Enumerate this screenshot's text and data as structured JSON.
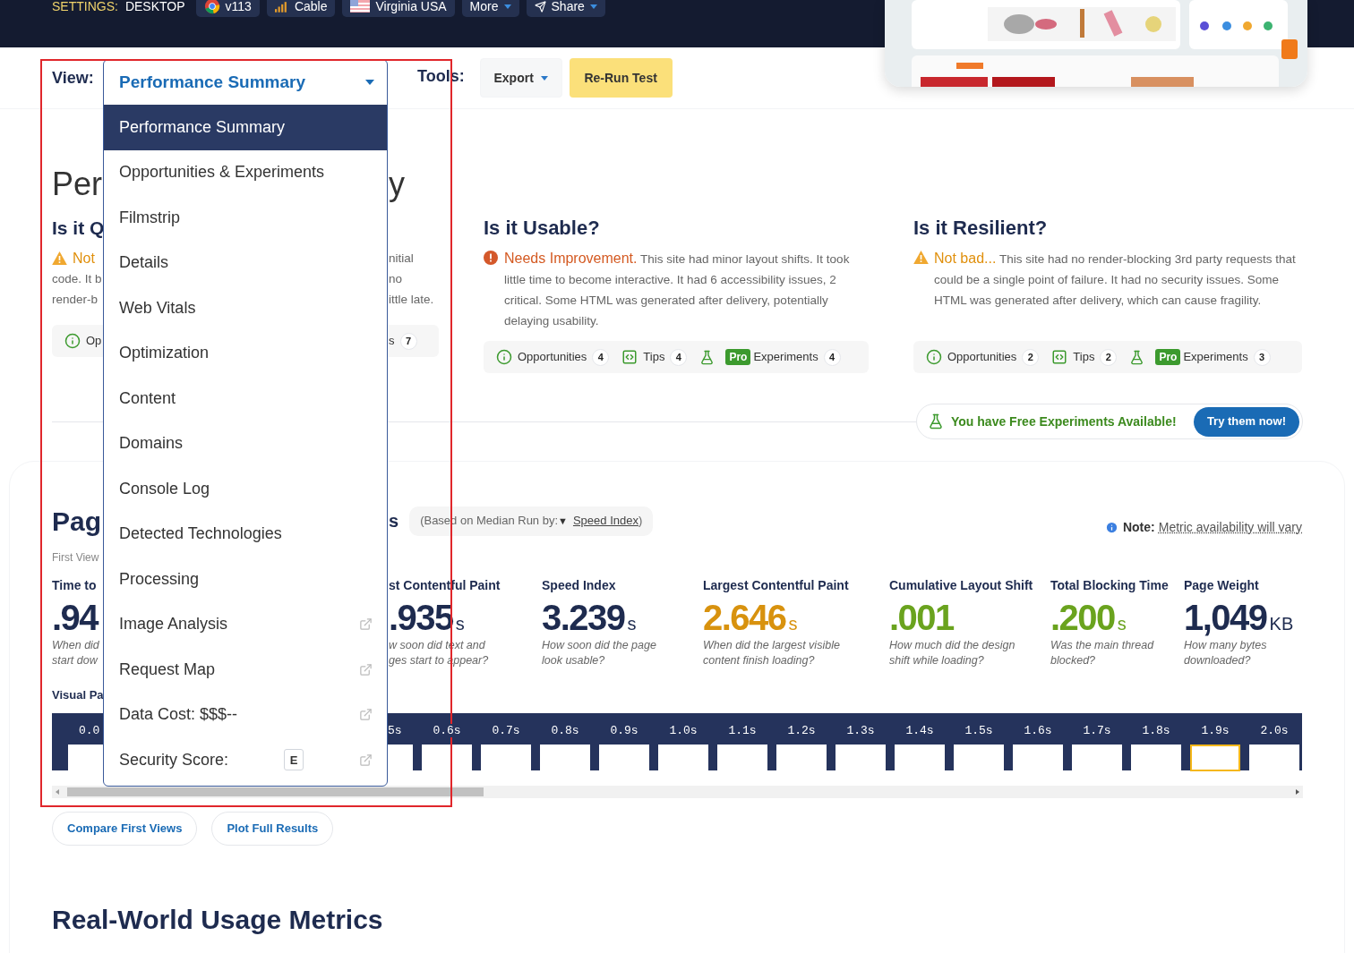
{
  "header": {
    "settings_label": "SETTINGS:",
    "settings_value": "DESKTOP",
    "chips": [
      {
        "kind": "browser",
        "label": "v113"
      },
      {
        "kind": "connection",
        "label": "Cable"
      },
      {
        "kind": "location",
        "label": "Virginia USA"
      },
      {
        "kind": "menu",
        "label": "More"
      },
      {
        "kind": "share",
        "label": "Share"
      }
    ]
  },
  "toolbar": {
    "view_label": "View:",
    "view_select": "Performance Summary",
    "tools_label": "Tools:",
    "export": "Export",
    "rerun": "Re-Run Test"
  },
  "view_menu": [
    {
      "label": "Performance Summary",
      "selected": true,
      "external": false
    },
    {
      "label": "Opportunities & Experiments",
      "selected": false,
      "external": false
    },
    {
      "label": "Filmstrip",
      "selected": false,
      "external": false
    },
    {
      "label": "Details",
      "selected": false,
      "external": false
    },
    {
      "label": "Web Vitals",
      "selected": false,
      "external": false
    },
    {
      "label": "Optimization",
      "selected": false,
      "external": false
    },
    {
      "label": "Content",
      "selected": false,
      "external": false
    },
    {
      "label": "Domains",
      "selected": false,
      "external": false
    },
    {
      "label": "Console Log",
      "selected": false,
      "external": false
    },
    {
      "label": "Detected Technologies",
      "selected": false,
      "external": false
    },
    {
      "label": "Processing",
      "selected": false,
      "external": false
    },
    {
      "label": "Image Analysis",
      "selected": false,
      "external": true
    },
    {
      "label": "Request Map",
      "selected": false,
      "external": true
    },
    {
      "label": "Data Cost: $$$--",
      "selected": false,
      "external": true
    },
    {
      "label": "Security Score:",
      "selected": false,
      "external": true,
      "badge": "E"
    }
  ],
  "summary": {
    "title_start": "Per",
    "title_end": "y",
    "left_section": {
      "heading": "Is it Q",
      "status": {
        "kind": "warning",
        "label": "Not"
      },
      "lines_left": [
        "code. It b",
        "render-b"
      ],
      "lines_right": [
        "nitial",
        "no",
        "ittle late."
      ],
      "chip_left": "Op",
      "chip_right": "s",
      "chip_right_count": "7"
    },
    "sections": [
      {
        "heading": "Is it Usable?",
        "status": {
          "kind": "error",
          "label": "Needs Improvement."
        },
        "text": "This site had minor layout shifts. It took little time to become interactive. It had 6 accessibility issues, 2 critical. Some HTML was generated after delivery, potentially delaying usability.",
        "opportunities": "Opportunities",
        "opportunities_count": "4",
        "tips": "Tips",
        "tips_count": "4",
        "pro": "Pro",
        "experiments": "Experiments",
        "experiments_count": "4"
      },
      {
        "heading": "Is it Resilient?",
        "status": {
          "kind": "warning",
          "label": "Not bad..."
        },
        "text": "This site had no render-blocking 3rd party requests that could be a single point of failure. It had no security issues. Some HTML was generated after delivery, which can cause fragility.",
        "opportunities": "Opportunities",
        "opportunities_count": "2",
        "tips": "Tips",
        "tips_count": "2",
        "pro": "Pro",
        "experiments": "Experiments",
        "experiments_count": "3"
      }
    ],
    "promo": {
      "text": "You have Free Experiments Available!",
      "button": "Try them now!"
    }
  },
  "metrics_section": {
    "title_start": "Pag",
    "title_end": "s",
    "median_prefix": "(Based on Median Run by:",
    "median_caret": "▼",
    "median_link": "Speed Index",
    "median_suffix": ")",
    "note_label": "Note:",
    "note_text": "Metric availability will vary",
    "view": "First View",
    "metrics": [
      {
        "label": "Time to",
        "value": ".94",
        "description": [
          "When did",
          "start dow"
        ],
        "color": "#1e2b4f"
      },
      {
        "label": "st Contentful Paint",
        "value": ".935",
        "unit": "s",
        "description": [
          "w soon did text and",
          "ges start to appear?"
        ],
        "color": "#1e2b4f"
      },
      {
        "label": "Speed Index",
        "value": "3.239",
        "unit": "s",
        "description": [
          "How soon did the page",
          "look usable?"
        ],
        "color": "#1e2b4f"
      },
      {
        "label": "Largest Contentful Paint",
        "value": "2.646",
        "unit": "s",
        "description": [
          "When did the largest visible",
          "content finish loading?"
        ],
        "color": "#d8920e"
      },
      {
        "label": "Cumulative Layout Shift",
        "value": ".001",
        "description": [
          "How much did the design",
          "shift while loading?"
        ],
        "color": "#6aa31e"
      },
      {
        "label": "Total Blocking Time",
        "value": ".200",
        "unit": "s",
        "description": [
          "Was the main thread",
          "blocked?"
        ],
        "color": "#6aa31e"
      },
      {
        "label": "Page Weight",
        "value": "1,049",
        "unit": "KB",
        "description": [
          "How many bytes",
          "downloaded?"
        ],
        "color": "#1e2b4f"
      }
    ],
    "filmstrip_label": "Visual Pa",
    "frames": [
      {
        "kind": "cut_right",
        "label": "0.0",
        "selected": false
      },
      {
        "kind": "cut_left",
        "label": "5s",
        "selected": false
      },
      {
        "kind": "full",
        "label": "0.6s",
        "selected": false
      },
      {
        "kind": "full",
        "label": "0.7s",
        "selected": false
      },
      {
        "kind": "full",
        "label": "0.8s",
        "selected": false
      },
      {
        "kind": "full",
        "label": "0.9s",
        "selected": false
      },
      {
        "kind": "full",
        "label": "1.0s",
        "selected": false
      },
      {
        "kind": "full",
        "label": "1.1s",
        "selected": false
      },
      {
        "kind": "full",
        "label": "1.2s",
        "selected": false
      },
      {
        "kind": "full",
        "label": "1.3s",
        "selected": false
      },
      {
        "kind": "full",
        "label": "1.4s",
        "selected": false
      },
      {
        "kind": "full",
        "label": "1.5s",
        "selected": false
      },
      {
        "kind": "full",
        "label": "1.6s",
        "selected": false
      },
      {
        "kind": "full",
        "label": "1.7s",
        "selected": false
      },
      {
        "kind": "full",
        "label": "1.8s",
        "selected": false
      },
      {
        "kind": "full",
        "label": "1.9s",
        "selected": true
      },
      {
        "kind": "full",
        "label": "2.0s",
        "selected": false
      }
    ],
    "buttons": [
      "Compare First Views",
      "Plot Full Results"
    ]
  },
  "real_world": {
    "title": "Real-World Usage Metrics"
  }
}
